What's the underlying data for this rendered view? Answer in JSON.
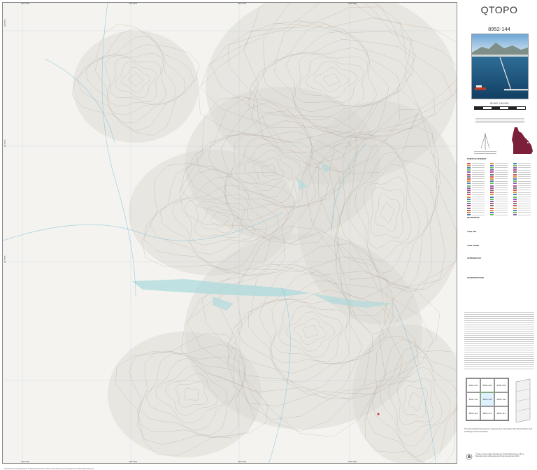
{
  "map": {
    "grid_top": [
      "148°30'E",
      "148°35'E",
      "148°40'E",
      "148°45'E"
    ],
    "grid_bottom": [
      "148°30'E",
      "148°35'E",
      "148°40'E",
      "148°45'E"
    ],
    "grid_left": [
      "20°55'S",
      "21°00'S",
      "21°05'S"
    ],
    "footer": "Produced by the Department of Natural Resources, Mines, Manufacturing and Regional and Rural Development."
  },
  "panel": {
    "title": "QTOPO",
    "sheet_number": "8952-144",
    "scale": "SCALE 1:50,000",
    "legend_heading": "POINTS OF INTEREST",
    "legend_sections": [
      "BOUNDARIES",
      "LAND USE",
      "LAND COVER",
      "HYDROGRAPHY",
      "TRANSPORTATION"
    ],
    "index": [
      "8952-231",
      "8952-232",
      "8952-233",
      "8952-141",
      "8952-144",
      "8952-143",
      "8952-112",
      "8952-113",
      "8952-114"
    ],
    "disclaimer": "The Queensland Government supports and encourages the dissemination and exchange of its information.",
    "copyright": "© State of Queensland (Department of Natural Resources, Mines, Manufacturing and Regional and Rural Development) 2023."
  },
  "colors": {
    "water": "#a9d8dc",
    "contour": "#9c8f80",
    "index_current": "#6fbf5f",
    "state": "#7b1f3a"
  }
}
